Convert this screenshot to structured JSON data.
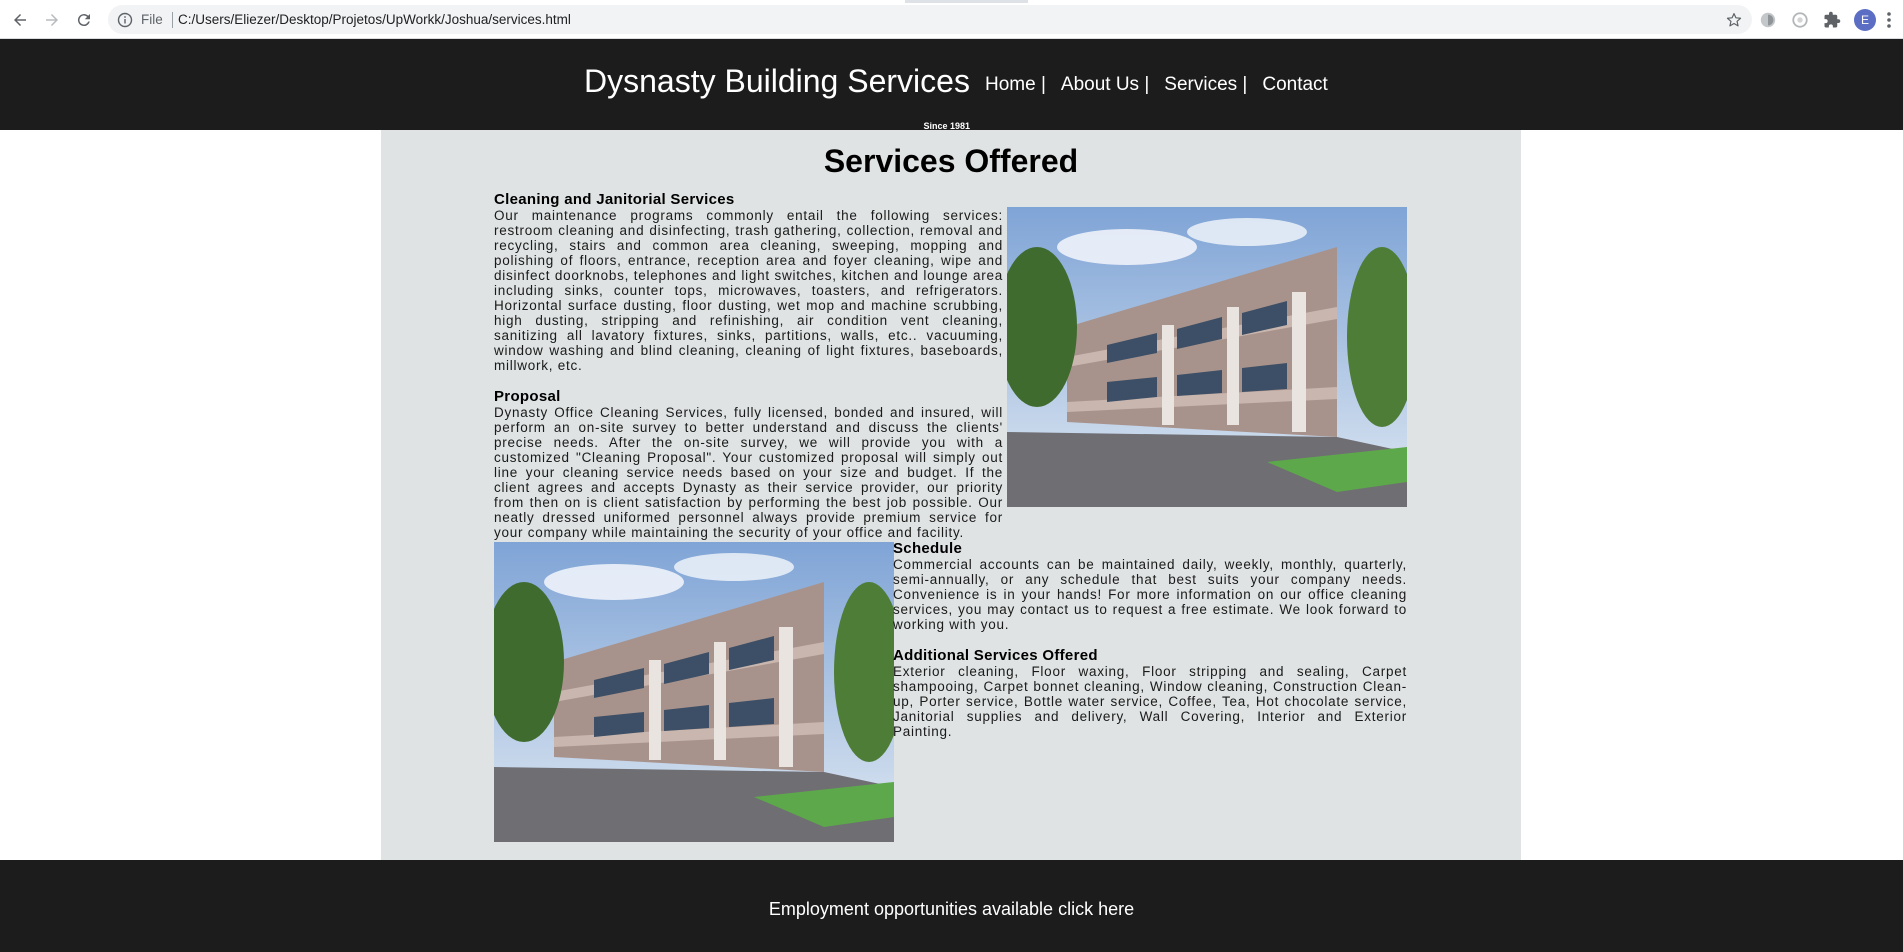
{
  "browser": {
    "scheme_label": "File",
    "url": "C:/Users/Eliezer/Desktop/Projetos/UpWorkk/Joshua/services.html",
    "profile_initial": "E"
  },
  "header": {
    "brand_title": "Dysnasty Building Services",
    "brand_since": "Since 1981",
    "nav": [
      "Home |",
      "About Us |",
      "Services |",
      "Contact"
    ]
  },
  "main": {
    "title": "Services Offered",
    "sections": [
      {
        "heading": "Cleaning and Janitorial Services",
        "body": "Our maintenance programs commonly entail the following services: restroom cleaning and disinfecting, trash gathering, collection, removal and recycling, stairs and common area cleaning, sweeping, mopping and polishing of floors, entrance, reception area and foyer cleaning, wipe and disinfect doorknobs, telephones and light switches, kitchen and lounge area including sinks, counter tops, microwaves, toasters, and refrigerators. Horizontal surface dusting, floor dusting, wet mop and machine scrubbing, high dusting, stripping and refinishing, air condition vent cleaning, sanitizing all lavatory fixtures, sinks, partitions, walls, etc.. vacuuming, window washing and blind cleaning, cleaning of light fixtures, baseboards, millwork, etc."
      },
      {
        "heading": "Proposal",
        "body": "Dynasty Office Cleaning Services, fully licensed, bonded and insured, will perform an on-site survey to better understand and discuss the clients' precise needs. After the on-site survey, we will provide you with a customized \"Cleaning Proposal\". Your customized proposal will simply out line your cleaning service needs based on your size and budget. If the client agrees and accepts Dynasty as their service provider, our priority from then on is client satisfaction by performing the best job possible. Our neatly dressed uniformed personnel always provide premium service for your company while maintaining the security of your office and facility."
      },
      {
        "heading": "Schedule",
        "body": "Commercial accounts can be maintained daily, weekly, monthly, quarterly, semi-annually, or any schedule that best suits your company needs. Convenience is in your hands! For more information on our office cleaning services, you may contact us to request a free estimate. We look forward to working with you."
      },
      {
        "heading": "Additional Services Offered",
        "body": "Exterior cleaning, Floor waxing, Floor stripping and sealing, Carpet shampooing, Carpet bonnet cleaning, Window cleaning, Construction Clean-up, Porter service, Bottle water service, Coffee, Tea, Hot chocolate service, Janitorial supplies and delivery, Wall Covering, Interior and Exterior Painting."
      }
    ]
  },
  "footer": {
    "link": "Employment opportunities available click here"
  },
  "colors": {
    "header_bg": "#1c1c1c",
    "panel_bg": "#dfe3e3",
    "building": "#a8938c"
  },
  "icons": [
    "back-icon",
    "forward-icon",
    "reload-icon",
    "info-icon",
    "star-icon",
    "extension-icon",
    "puzzle-icon",
    "menu-icon"
  ]
}
